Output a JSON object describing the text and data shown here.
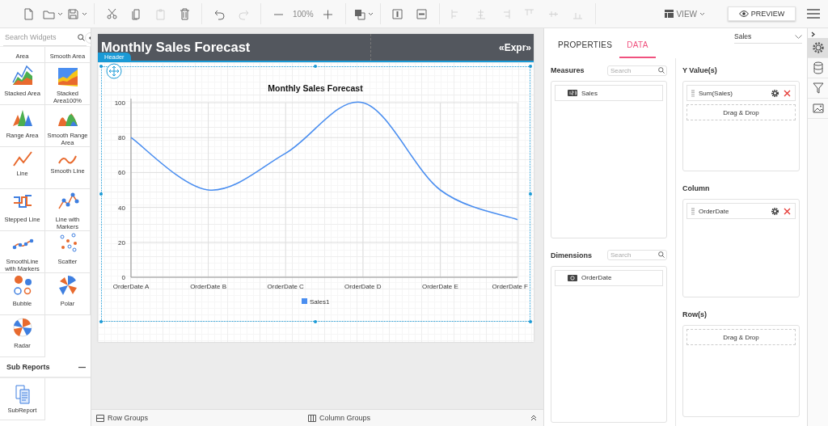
{
  "toolbar": {
    "buttons": [
      {
        "disabled": false
      },
      {
        "disabled": false
      },
      {
        "disabled": false
      },
      {
        "disabled": false
      },
      {
        "disabled": false
      },
      {
        "disabled": true
      },
      {
        "disabled": false
      },
      {
        "disabled": false
      },
      {
        "disabled": true
      },
      {
        "disabled": false
      },
      {
        "disabled": false
      },
      {
        "disabled": false
      },
      {
        "disabled": false
      },
      {
        "disabled": false
      },
      {
        "disabled": true
      },
      {
        "disabled": true
      },
      {
        "disabled": true
      },
      {
        "disabled": true
      },
      {
        "disabled": true
      },
      {
        "disabled": true
      }
    ],
    "zoom": "100%",
    "view": "VIEW",
    "preview": "PREVIEW"
  },
  "widgets": {
    "search": {
      "placeholder": "Search Widgets"
    },
    "items": [
      {
        "label": "Area"
      },
      {
        "label": "Smooth Area"
      },
      {
        "label": "Stacked Area"
      },
      {
        "label": "Stacked Area100%"
      },
      {
        "label": "Range Area"
      },
      {
        "label": "Smooth Range Area"
      },
      {
        "label": "Line"
      },
      {
        "label": "Smooth Line"
      },
      {
        "label": "Stepped Line"
      },
      {
        "label": "Line with Markers"
      },
      {
        "label": "SmoothLine with Markers"
      },
      {
        "label": "Scatter"
      },
      {
        "label": "Bubble"
      },
      {
        "label": "Polar"
      },
      {
        "label": "Radar"
      }
    ],
    "sections": [
      {
        "title": "Sub Reports",
        "expanded": true,
        "items": [
          {
            "label": "SubReport"
          }
        ]
      }
    ]
  },
  "canvas": {
    "header": {
      "title": "Monthly Sales Forecast",
      "expression": "«Expr»",
      "band_label": "Header"
    },
    "chart": {
      "chart_data": {
        "type": "line",
        "title": "Monthly Sales Forecast",
        "categories": [
          "OrderDate A",
          "OrderDate B",
          "OrderDate C",
          "OrderDate D",
          "OrderDate E",
          "OrderDate F"
        ],
        "series": [
          {
            "name": "Sales1",
            "color": "#4a8ef0",
            "values": [
              80,
              50,
              71,
              100,
              50,
              33
            ]
          }
        ],
        "ylim": [
          0,
          100
        ],
        "grid": true,
        "yticks": [
          0,
          20,
          40,
          60,
          80,
          100
        ]
      }
    },
    "footer": {
      "row_groups": "Row Groups",
      "column_groups": "Column Groups"
    }
  },
  "data_panel": {
    "tabs": [
      {
        "label": "PROPERTIES",
        "selected": false
      },
      {
        "label": "DATA",
        "selected": true
      }
    ],
    "dataset": "Sales",
    "measures": {
      "title": "Measures",
      "search": {
        "placeholder": "Search"
      },
      "items": [
        {
          "label": "Sales"
        }
      ]
    },
    "dimensions": {
      "title": "Dimensions",
      "search": {
        "placeholder": "Search"
      },
      "items": [
        {
          "label": "OrderDate"
        }
      ]
    },
    "y_values": {
      "title": "Y Value(s)",
      "items": [
        {
          "label": "Sum(Sales)"
        }
      ],
      "drop": "Drag & Drop"
    },
    "column": {
      "title": "Column",
      "items": [
        {
          "label": "OrderDate"
        }
      ]
    },
    "rows": {
      "title": "Row(s)",
      "drop": "Drag & Drop"
    }
  },
  "side_strip": [
    {
      "selected": true
    },
    {
      "selected": false
    },
    {
      "selected": false
    },
    {
      "selected": false
    }
  ]
}
